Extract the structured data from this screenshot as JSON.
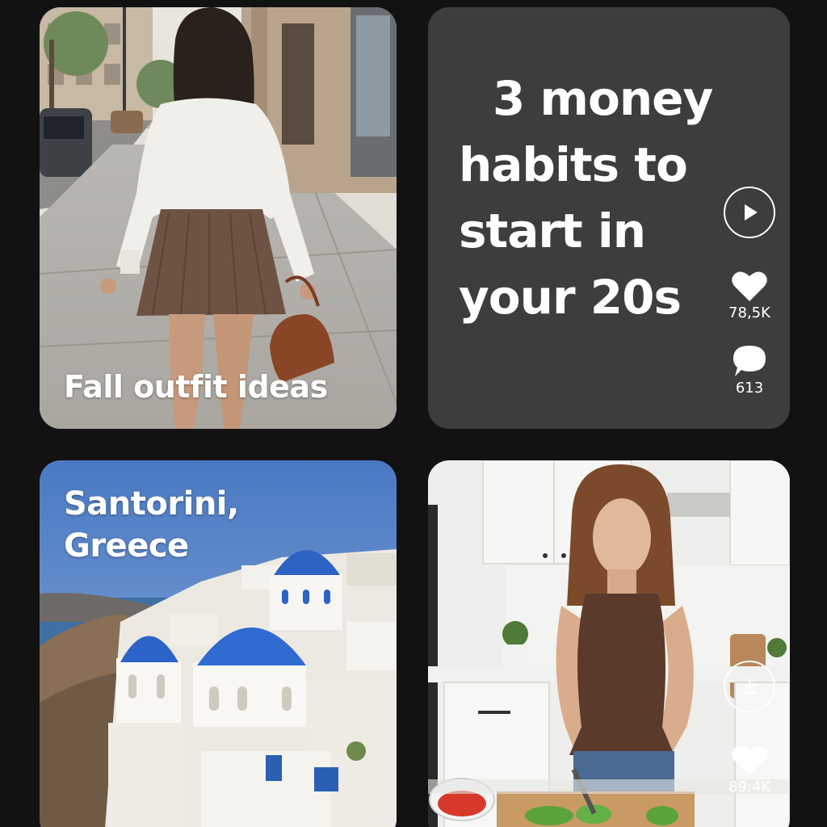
{
  "feed": {
    "cards": [
      {
        "title": "Fall outfit ideas"
      },
      {
        "title_lines": [
          "3 money",
          "habits to",
          "start in",
          "your 20s"
        ],
        "likes": "78,5K",
        "comments": "613",
        "play_icon": "play-icon",
        "like_icon": "heart-icon",
        "comment_icon": "comment-icon"
      },
      {
        "title_lines": [
          "Santorini,",
          "Greece"
        ]
      },
      {
        "likes": "89:4K",
        "download_icon": "download-icon",
        "like_icon": "heart-icon"
      }
    ]
  },
  "colors": {
    "background": "#121212",
    "text_card": "#3d3d3d",
    "overlay_text": "#ffffff"
  }
}
